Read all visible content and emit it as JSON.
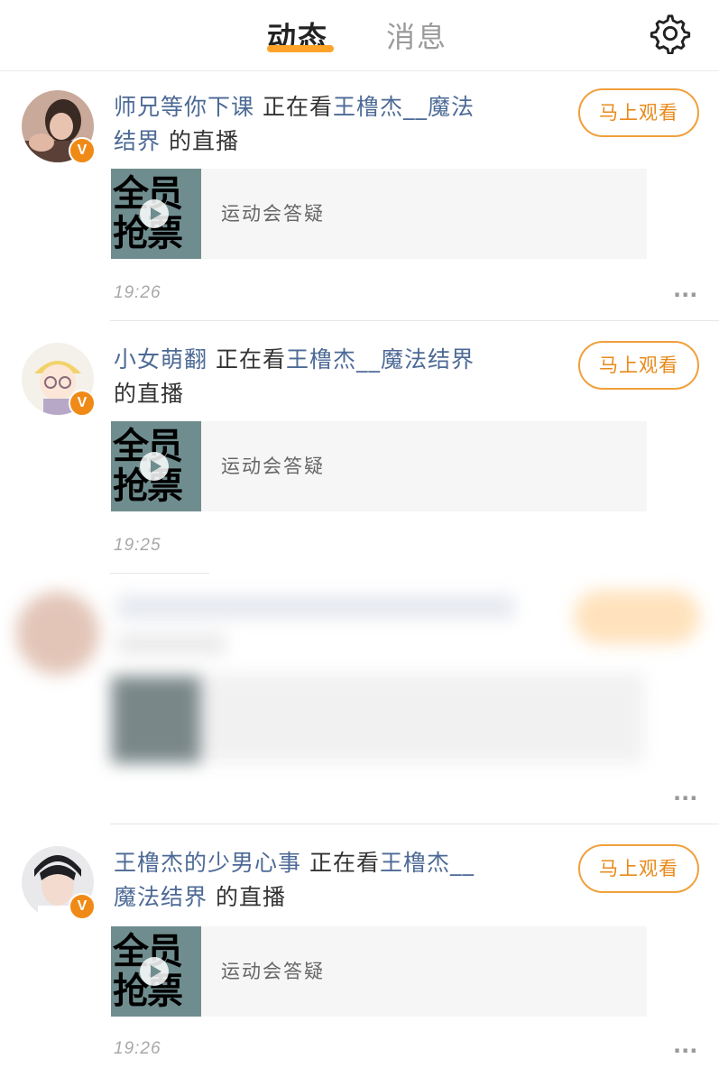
{
  "header": {
    "tabs": [
      {
        "label": "动态",
        "active": true
      },
      {
        "label": "消息",
        "active": false
      }
    ],
    "settings_icon": "gear-icon",
    "accent": "#ffa32a"
  },
  "feed": [
    {
      "user": "师兄等你下课",
      "verb": "正在看",
      "target_line1": "王橹杰__魔法",
      "target_line2": "结界",
      "suffix": "的直播",
      "button": "马上观看",
      "thumb_text": [
        "全员",
        "抢票"
      ],
      "card_title": "运动会答疑",
      "time": "19:26",
      "more": "···"
    },
    {
      "user": "小女萌翻",
      "verb": "正在看",
      "target": "王橹杰__魔法结界",
      "suffix": "的直播",
      "button": "马上观看",
      "thumb_text": [
        "全员",
        "抢票"
      ],
      "card_title": "运动会答疑",
      "time": "19:25"
    },
    {
      "more": "···"
    },
    {
      "user": "王橹杰的少男心事",
      "verb": "正在看",
      "target_line1": "王橹杰__",
      "target_line2": "魔法结界",
      "suffix": "的直播",
      "button": "马上观看",
      "thumb_text": [
        "全员",
        "抢票"
      ],
      "card_title": "运动会答疑",
      "time": "19:26",
      "more": "···"
    }
  ],
  "colors": {
    "link": "#4d6a96",
    "badge": "#f08a16",
    "button_border": "#f0a03c",
    "button_text": "#e88a1a"
  },
  "verified_badge": "V"
}
